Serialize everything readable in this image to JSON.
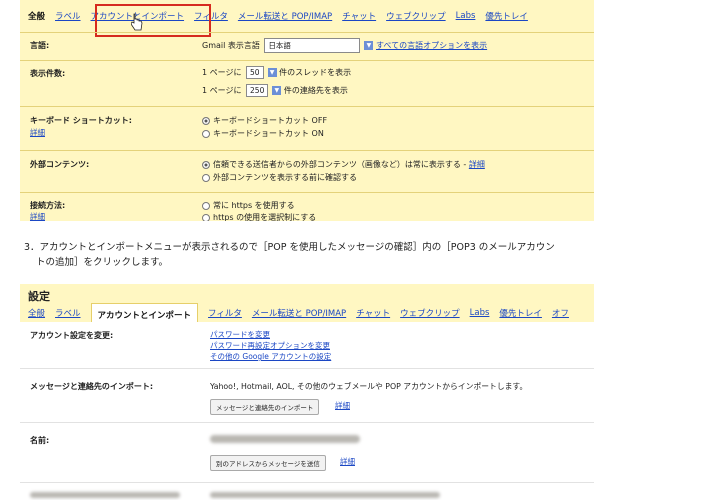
{
  "shot1": {
    "tabs": [
      "全般",
      "ラベル",
      "アカウントとインポート",
      "フィルタ",
      "メール転送と POP/IMAP",
      "チャット",
      "ウェブクリップ",
      "Labs",
      "優先トレイ"
    ],
    "language": {
      "label": "言語:",
      "prefix": "Gmail 表示言語",
      "value": "日本語",
      "link": "すべての言語オプションを表示"
    },
    "page_size": {
      "label": "表示件数:",
      "line1_pre": "1 ページに",
      "line1_value": "50",
      "line1_post": "件のスレッドを表示",
      "line2_pre": "1 ページに",
      "line2_value": "250",
      "line2_post": "件の連絡先を表示"
    },
    "shortcuts": {
      "label": "キーボード ショートカット:",
      "sub": "詳細",
      "opt1": "キーボードショートカット OFF",
      "opt2": "キーボードショートカット ON"
    },
    "external": {
      "label": "外部コンテンツ:",
      "opt1": "信頼できる送信者からの外部コンテンツ（画像など）は常に表示する -",
      "opt1_link": "詳細",
      "opt2": "外部コンテンツを表示する前に確認する"
    },
    "connection": {
      "label": "接続方法:",
      "sub": "詳細",
      "opt1": "常に https を使用する",
      "opt2": "https の使用を選択制にする"
    }
  },
  "instruction": {
    "line1": "3．アカウントとインポートメニューが表示されるので［POP を使用したメッセージの確認］内の［POP3 のメールアカウン",
    "line2": "トの追加］をクリックします。"
  },
  "shot2": {
    "title": "設定",
    "tabs": [
      "全般",
      "ラベル",
      "アカウントとインポート",
      "フィルタ",
      "メール転送と POP/IMAP",
      "チャット",
      "ウェブクリップ",
      "Labs",
      "優先トレイ",
      "オフ"
    ],
    "account": {
      "label": "アカウント設定を変更:",
      "links": [
        "パスワードを変更",
        "パスワード再設定オプションを変更",
        "その他の Google アカウントの設定"
      ]
    },
    "import": {
      "label": "メッセージと連絡先のインポート:",
      "text": "Yahoo!, Hotmail, AOL, その他のウェブメールや POP アカウントからインポートします。",
      "button": "メッセージと連絡先のインポート",
      "link": "詳細"
    },
    "name": {
      "label": "名前:",
      "button": "別のアドレスからメッセージを送信",
      "link": "詳細"
    }
  }
}
